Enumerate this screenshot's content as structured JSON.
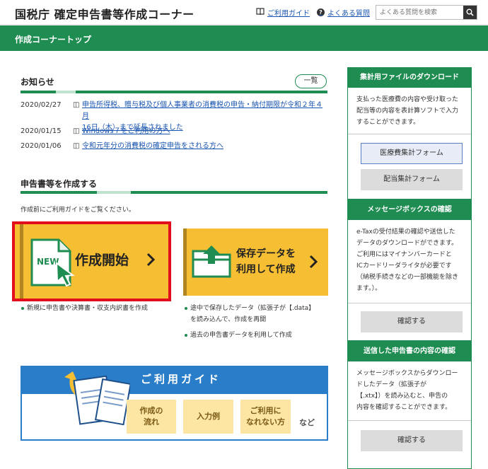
{
  "header": {
    "site_title": "国税庁 確定申告書等作成コーナー",
    "guide_link": "ご利用ガイド",
    "faq_link": "よくある質問",
    "search_placeholder": "よくある質問を検索"
  },
  "nav_bar": {
    "title": "作成コーナートップ"
  },
  "news": {
    "title": "お知らせ",
    "list_button": "一覧",
    "items": [
      {
        "date": "2020/02/27",
        "text": "申告所得税、贈与税及び個人事業者の消費税の申告・納付期限が令和２年４月",
        "text2": "16日（木）まで延長されました"
      },
      {
        "date": "2020/01/15",
        "text": "Windows７をご利用の方へ"
      },
      {
        "date": "2020/01/06",
        "text": "令和元年分の消費税の確定申告をされる方へ"
      }
    ]
  },
  "create": {
    "title": "申告書等を作成する",
    "note": "作成前にご利用ガイドをご覧ください。",
    "start_button": {
      "badge": "NEW",
      "label": "作成開始"
    },
    "saved_button": {
      "line1": "保存データを",
      "line2": "利用して作成"
    },
    "start_bullets": [
      "新規に申告書や決算書・収支内訳書を作成"
    ],
    "saved_bullets": [
      "途中で保存したデータ（拡張子が【.data】",
      "を読み込んで、作成を再開",
      "過去の申告書データを利用して作成"
    ]
  },
  "guide_banner": {
    "title": "ご利用ガイド",
    "buttons": [
      {
        "line1": "作成の",
        "line2": "流れ"
      },
      {
        "line1": "入力例",
        "line2": ""
      },
      {
        "line1": "ご利用に",
        "line2": "なれない方"
      }
    ],
    "etc": "など"
  },
  "sidebar": {
    "aggregate": {
      "title": "集計用ファイルのダウンロード",
      "text": [
        "支払った医療費の内容や受け取った",
        "配当等の内容を表計算ソフトで入力",
        "することができます。"
      ],
      "button1": "医療費集計フォーム",
      "button2": "配当集計フォーム"
    },
    "messagebox": {
      "title": "メッセージボックスの確認",
      "text": [
        "e-Taxの受付結果の確認や送信した",
        "データのダウンロードができます。",
        "ご利用にはマイナンバーカードと",
        "ICカードリーダライタが必要です",
        "（納税手続きなどの一部機能を除き",
        "ます。）。"
      ],
      "button": "確認する"
    },
    "sent": {
      "title": "送信した申告書の内容の確認",
      "text": [
        "メッセージボックスからダウンロー",
        "ドしたデータ（拡張子が",
        "【.xtx】）を読み込むと、申告の",
        "内容を確認することができます。"
      ],
      "button": "確認する"
    }
  },
  "colors": {
    "green": "#1f8c52",
    "yellow": "#f6be32",
    "blue": "#2a7dc8",
    "red": "#e30e1b",
    "link": "#1a55b0"
  },
  "icons": [
    "book-icon",
    "question-icon",
    "search-icon",
    "document-icon",
    "chevron-right-icon",
    "folder-upload-icon",
    "cursor-icon"
  ]
}
